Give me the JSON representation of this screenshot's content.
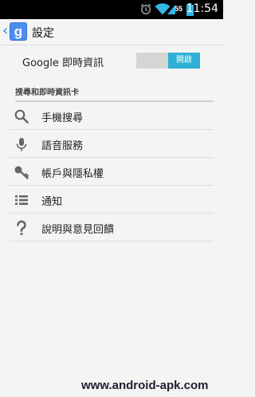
{
  "status_bar": {
    "battery_level": "55",
    "time": "11:54",
    "icons": [
      "alarm-icon",
      "wifi-icon",
      "signal-icon",
      "battery-icon"
    ]
  },
  "action_bar": {
    "logo_letter": "g",
    "title": "設定"
  },
  "master_switch": {
    "label": "Google 即時資訊",
    "state_label": "開啟",
    "on": true
  },
  "section": {
    "header": "搜尋和即時資訊卡",
    "items": [
      {
        "label": "手機搜尋",
        "icon": "search-icon"
      },
      {
        "label": "語音服務",
        "icon": "microphone-icon"
      },
      {
        "label": "帳戶與隱私權",
        "icon": "key-icon"
      },
      {
        "label": "通知",
        "icon": "list-icon"
      },
      {
        "label": "說明與意見回饋",
        "icon": "help-icon"
      }
    ]
  },
  "watermark": "www.android-apk.com",
  "colors": {
    "accent": "#2fb1d6",
    "status_bar": "#000000",
    "background": "#f4f4f4"
  }
}
